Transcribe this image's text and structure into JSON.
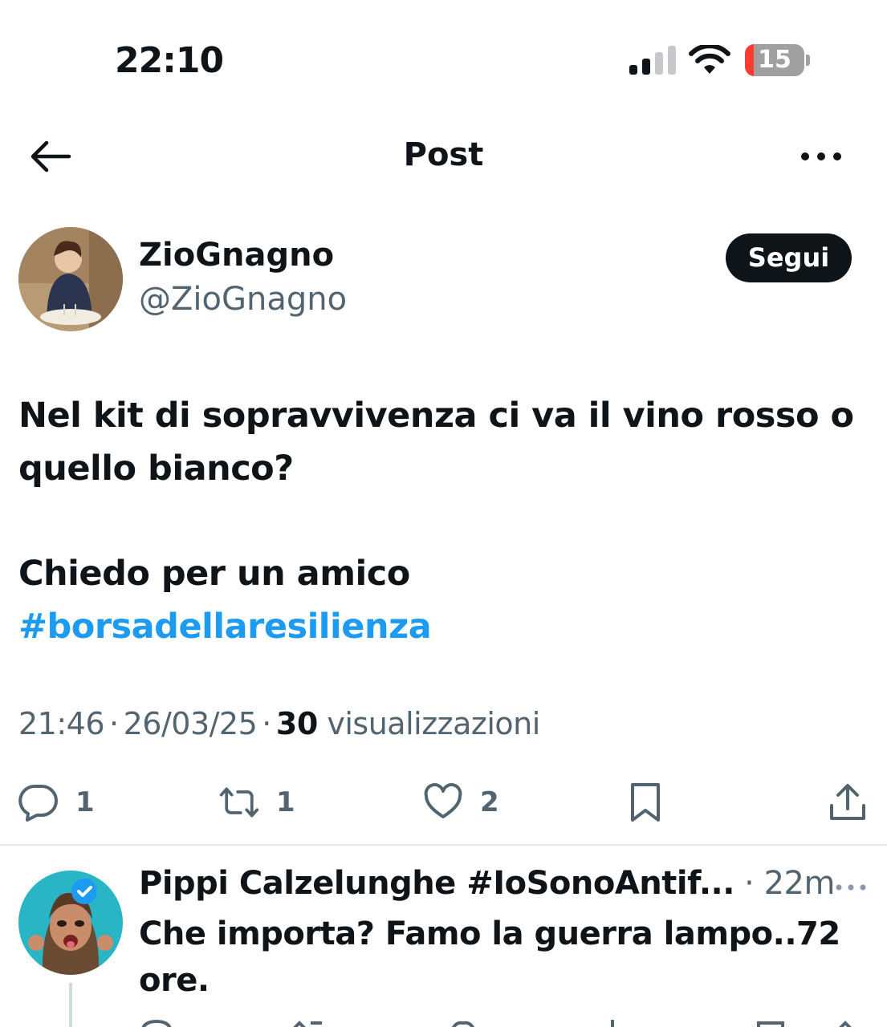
{
  "status_bar": {
    "time": "22:10",
    "battery_level": "15",
    "battery_fraction": 0.15
  },
  "nav": {
    "title": "Post",
    "back_icon": "arrow-left-icon",
    "more_icon": "more-horizontal-icon"
  },
  "post": {
    "author_name": "ZioGnagno",
    "author_handle": "@ZioGnagno",
    "follow_label": "Segui",
    "text_line1": "Nel kit di sopravvivenza ci va il vino rosso o quello bianco?",
    "text_line2": "Chiedo per un amico",
    "hashtag": "#borsadellaresilienza",
    "time": "21:46",
    "date": "26/03/25",
    "views_count": "30",
    "views_label": "visualizzazioni",
    "stats": {
      "replies": "1",
      "reposts": "1",
      "likes": "2"
    }
  },
  "reply": {
    "author_name": "Pippi Calzelunghe #IoSonoAntif...",
    "time": "22m",
    "text": "Che importa? Famo la guerra lampo..72 ore."
  },
  "colors": {
    "accent": "#1d9bf0",
    "text": "#0f1419",
    "secondary": "#536471",
    "battery_low": "#ff3b30"
  }
}
